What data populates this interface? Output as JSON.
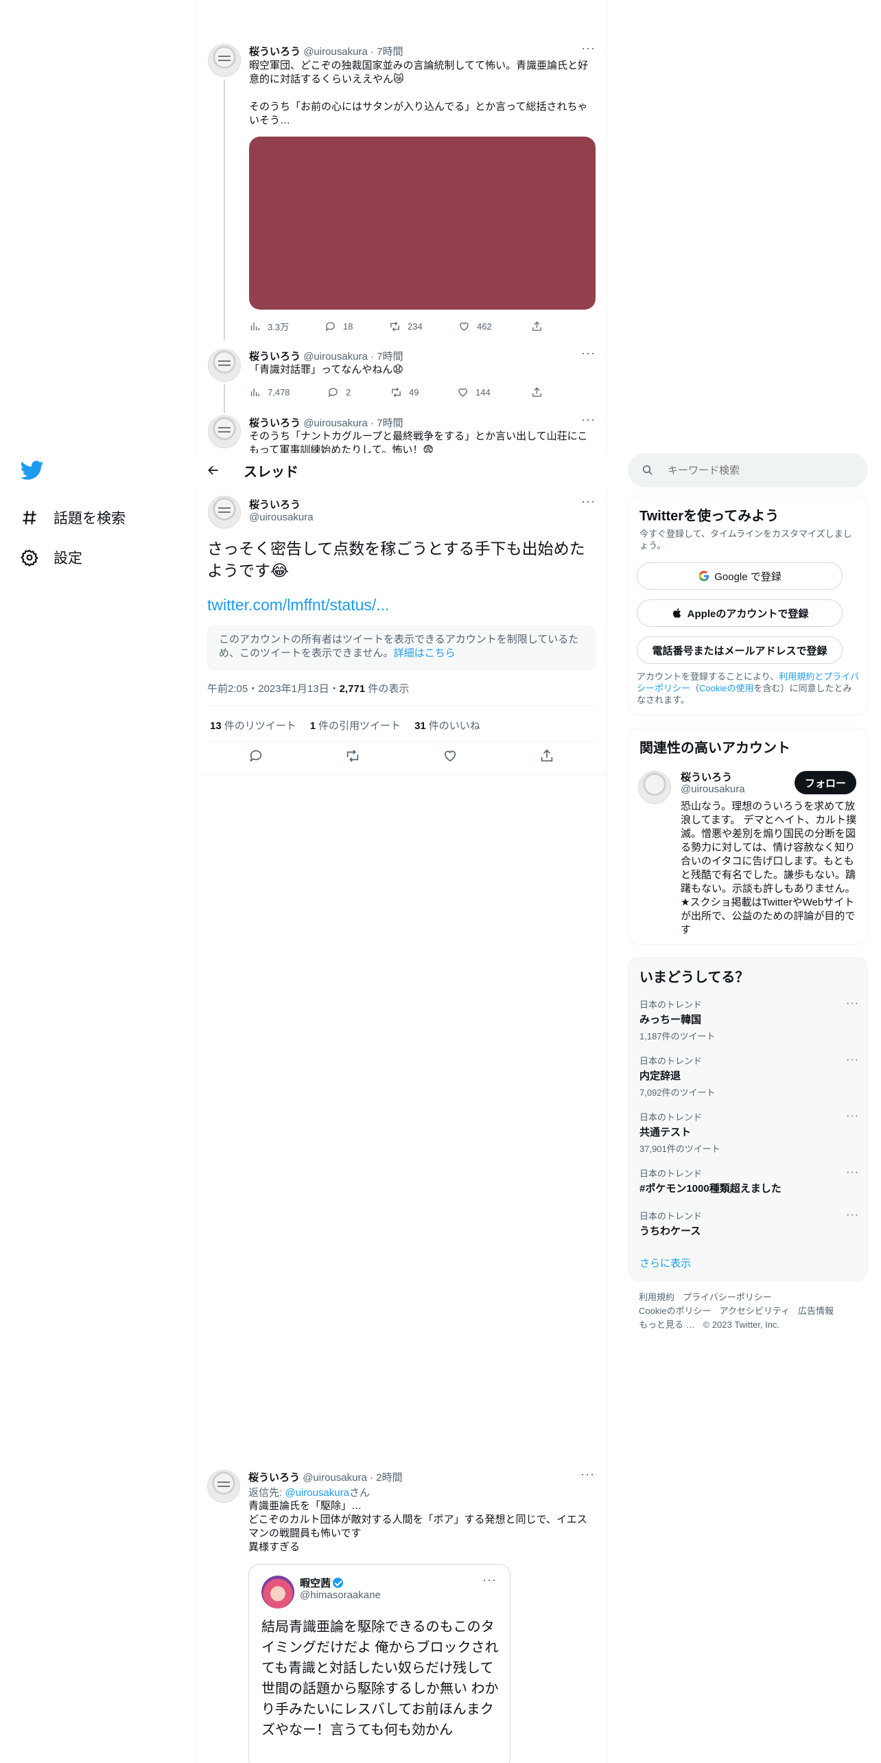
{
  "nav": {
    "items": [
      {
        "label": "話題を検索",
        "icon": "hashtag-icon"
      },
      {
        "label": "設定",
        "icon": "gear-icon"
      }
    ]
  },
  "thread": {
    "title": "スレッド"
  },
  "tweets": [
    {
      "name": "桜ういろう",
      "handle": "@uirousakura",
      "time": "7時間",
      "text": "暇空軍団、どこぞの独裁国家並みの言論統制してて怖い。青識亜論氏と好意的に対話するくらいええやん😿\n\nそのうち「お前の心にはサタンが入り込んでる」とか言って総括されちゃいそう…",
      "views": "3.3万",
      "replies": "18",
      "retweets": "234",
      "likes": "462"
    },
    {
      "name": "桜ういろう",
      "handle": "@uirousakura",
      "time": "7時間",
      "text": "「青識対話罪」ってなんやねん😧",
      "views": "7,478",
      "replies": "2",
      "retweets": "49",
      "likes": "144"
    },
    {
      "name": "桜ういろう",
      "handle": "@uirousakura",
      "time": "7時間",
      "text": "そのうち「ナントカグループと最終戦争をする」とか言い出して山荘にこもって軍事訓練始めたりして。怖い！😨"
    }
  ],
  "focus": {
    "name": "桜ういろう",
    "handle": "@uirousakura",
    "text": "さっそく密告して点数を稼ごうとする手下も出始めたようです😂",
    "link": "twitter.com/lmffnt/status/...",
    "notice": "このアカウントの所有者はツイートを表示できるアカウントを制限しているため、このツイートを表示できません。",
    "notice_link": "詳細はこちら",
    "timestamp": "午前2:05・2023年1月13日・",
    "views": "2,771",
    "views_label": "件の表示",
    "retweets": "13",
    "retweets_label": "件のリツイート",
    "quotes": "1",
    "quotes_label": "件の引用ツイート",
    "likes": "31",
    "likes_label": "件のいいね"
  },
  "reply": {
    "name": "桜ういろう",
    "handle": "@uirousakura",
    "time": "2時間",
    "reply_to_prefix": "返信先: ",
    "reply_to_handle": "@uirousakura",
    "reply_to_suffix": "さん",
    "text": "青識亜論氏を「駆除」…\nどこぞのカルト団体が敵対する人間を「ポア」する発想と同じで、イエスマンの戦闘員も怖いです\n異様すぎる",
    "quote": {
      "name": "暇空茜",
      "handle": "@himasoraakane",
      "text": "結局青識亜論を駆除できるのもこのタイミングだけだよ\n俺からブロックされても青識と対話したい奴らだけ残して世間の話題から駆除するしか無い\nわかり手みたいにレスバしてお前ほんまクズやなー！言うても何も効かん"
    }
  },
  "search": {
    "placeholder": "キーワード検索"
  },
  "signup": {
    "title": "Twitterを使ってみよう",
    "sub": "今すぐ登録して、タイムラインをカスタマイズしましょう。",
    "google": "Google で登録",
    "apple": "Appleのアカウントで登録",
    "phone": "電話番号またはメールアドレスで登録",
    "terms_prefix": "アカウントを登録することにより、",
    "terms_link1": "利用規約とプライバシーポリシー",
    "terms_mid": "（",
    "terms_link2": "Cookieの使用",
    "terms_suffix": "を含む）に同意したとみなされます。"
  },
  "related": {
    "title": "関連性の高いアカウント",
    "name": "桜ういろう",
    "handle": "@uirousakura",
    "follow": "フォロー",
    "bio": "恐山なう。理想のういろうを求めて放浪してます。 デマとヘイト、カルト撲滅。憎悪や差別を煽り国民の分断を図る勢力に対しては、情け容赦なく知り合いのイタコに告げ口します。もともと残酷で有名でした。謙歩もない。躊躇もない。示談も許しもありません。★スクショ掲載はTwitterやWebサイトが出所で、公益のための評論が目的です"
  },
  "trends": {
    "title": "いまどうしてる？",
    "items": [
      {
        "context": "日本のトレンド",
        "name": "みっちー韓国",
        "count": "1,187件のツイート"
      },
      {
        "context": "日本のトレンド",
        "name": "内定辞退",
        "count": "7,092件のツイート"
      },
      {
        "context": "日本のトレンド",
        "name": "共通テスト",
        "count": "37,901件のツイート"
      },
      {
        "context": "日本のトレンド",
        "name": "#ポケモン1000種類超えました",
        "count": ""
      },
      {
        "context": "日本のトレンド",
        "name": "うちわケース",
        "count": ""
      }
    ],
    "show_more": "さらに表示"
  },
  "footer": {
    "links": [
      "利用規約",
      "プライバシーポリシー",
      "Cookieのポリシー",
      "アクセシビリティ",
      "広告情報",
      "もっと見る …"
    ],
    "copyright": "© 2023 Twitter, Inc."
  },
  "colors": {
    "accent": "#1d9bf0",
    "media": "#923f4e",
    "text": "#0f1419",
    "muted": "#536471"
  }
}
